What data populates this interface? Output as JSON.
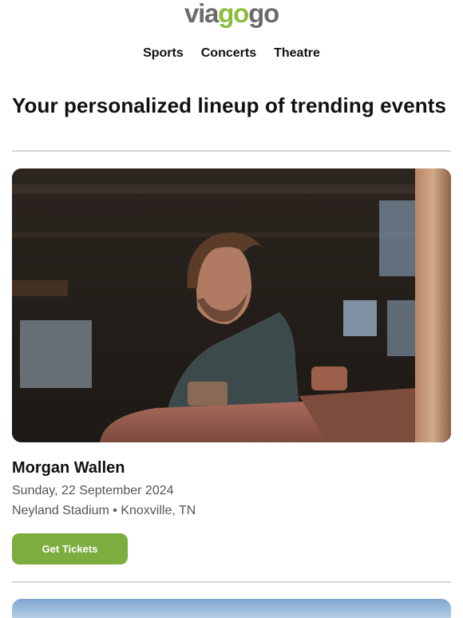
{
  "brand": {
    "part1": "via",
    "part2": "go",
    "part3": "go"
  },
  "nav": {
    "items": [
      "Sports",
      "Concerts",
      "Theatre"
    ]
  },
  "headline": "Your personalized lineup of trending events",
  "event": {
    "title": "Morgan Wallen",
    "date": "Sunday, 22 September 2024",
    "venue": "Neyland Stadium • Knoxville, TN",
    "cta_label": "Get Tickets",
    "image_icon": "artist-photo"
  },
  "colors": {
    "accent": "#7cad3e",
    "logo_green": "#8bbd3b",
    "logo_gray": "#6b6b6b"
  }
}
